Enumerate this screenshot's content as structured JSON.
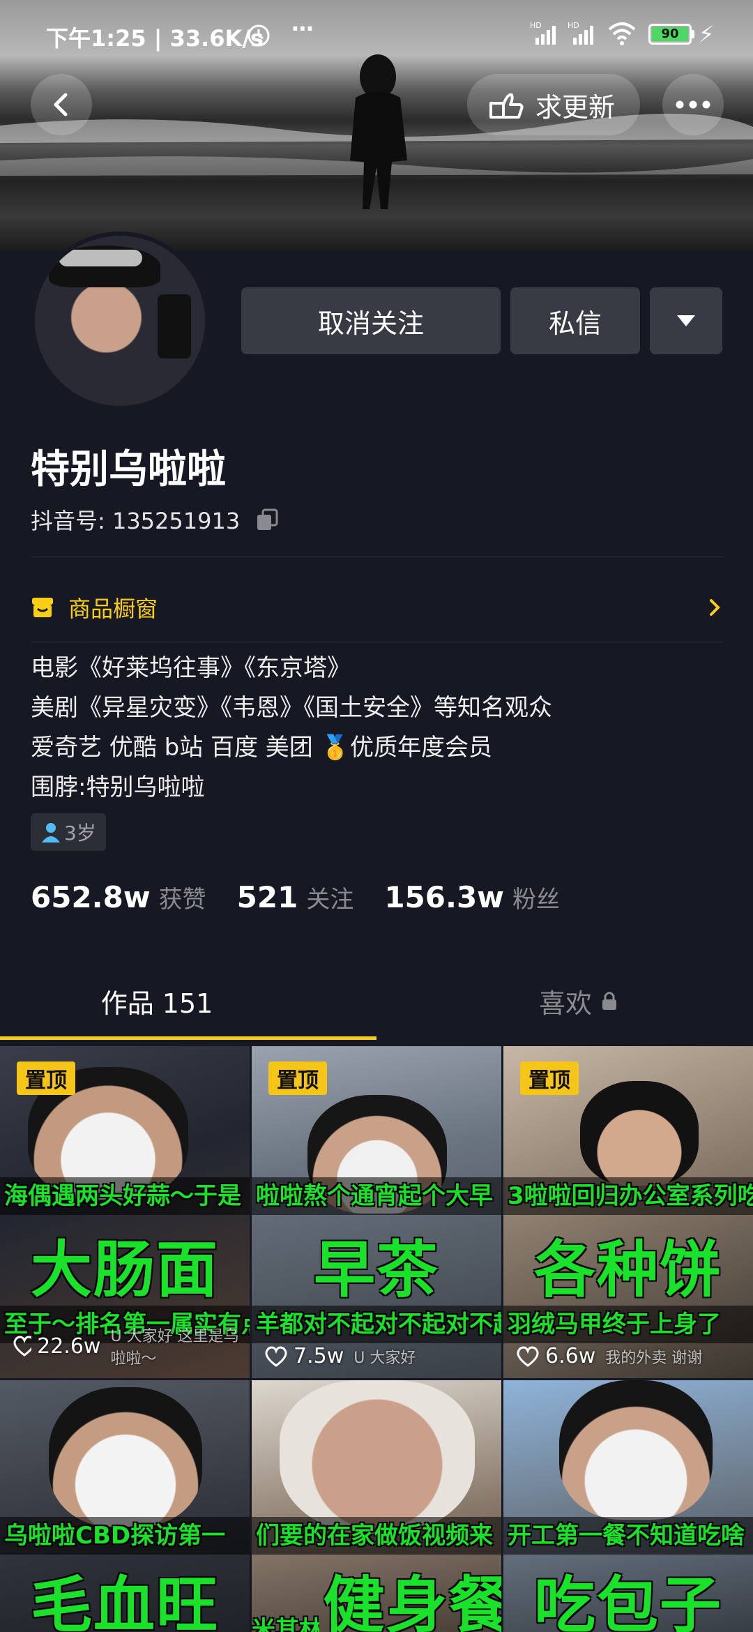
{
  "status_bar": {
    "time": "下午1:25 | 33.6K/s",
    "battery": "90"
  },
  "header": {
    "request_update_label": "求更新"
  },
  "profile": {
    "unfollow_label": "取消关注",
    "message_label": "私信",
    "name": "特别乌啦啦",
    "douyin_id_label": "抖音号: 135251913",
    "shop_label": "商品橱窗",
    "bio": [
      "电影《好莱坞往事》《东京塔》",
      "美剧《异星灾变》《韦恩》《国土安全》等知名观众",
      "爱奇艺 优酷 b站 百度 美团 🥇优质年度会员",
      "围脖:特别乌啦啦"
    ],
    "age_tag": "3岁",
    "stats": {
      "likes_value": "652.8w",
      "likes_label": "获赞",
      "following_value": "521",
      "following_label": "关注",
      "followers_value": "156.3w",
      "followers_label": "粉丝"
    }
  },
  "tabs": {
    "works": "作品 151",
    "favorites": "喜欢"
  },
  "videos": [
    {
      "pin": "置顶",
      "top_text": "海偶遇两头好蒜～于是",
      "title": "大肠面",
      "bottom_text": "至于～排名第一属实有点",
      "likes": "22.6w",
      "caption": "U 大家好 这里是乌啦啦～"
    },
    {
      "pin": "置顶",
      "top_text": "啦啦熬个通宵起个大早",
      "title": "早茶",
      "bottom_text": "羊都对不起对不起对不起",
      "likes": "7.5w",
      "caption": "U 大家好"
    },
    {
      "pin": "置顶",
      "top_text": "3啦啦回归办公室系列吃",
      "title": "各种饼",
      "bottom_text": "羽绒马甲终于上身了",
      "likes": "6.6w",
      "caption": "我的外卖 谢谢"
    },
    {
      "top_text": "乌啦啦CBD探访第一",
      "title": "毛血旺"
    },
    {
      "top_text": "们要的在家做饭视频来",
      "title": "健身餐",
      "prefix": "米其林"
    },
    {
      "top_text": "开工第一餐不知道吃啥",
      "title": "吃包子"
    }
  ],
  "colors": {
    "accent": "#face15",
    "background": "#161823",
    "title_green": "#1ae22a"
  }
}
